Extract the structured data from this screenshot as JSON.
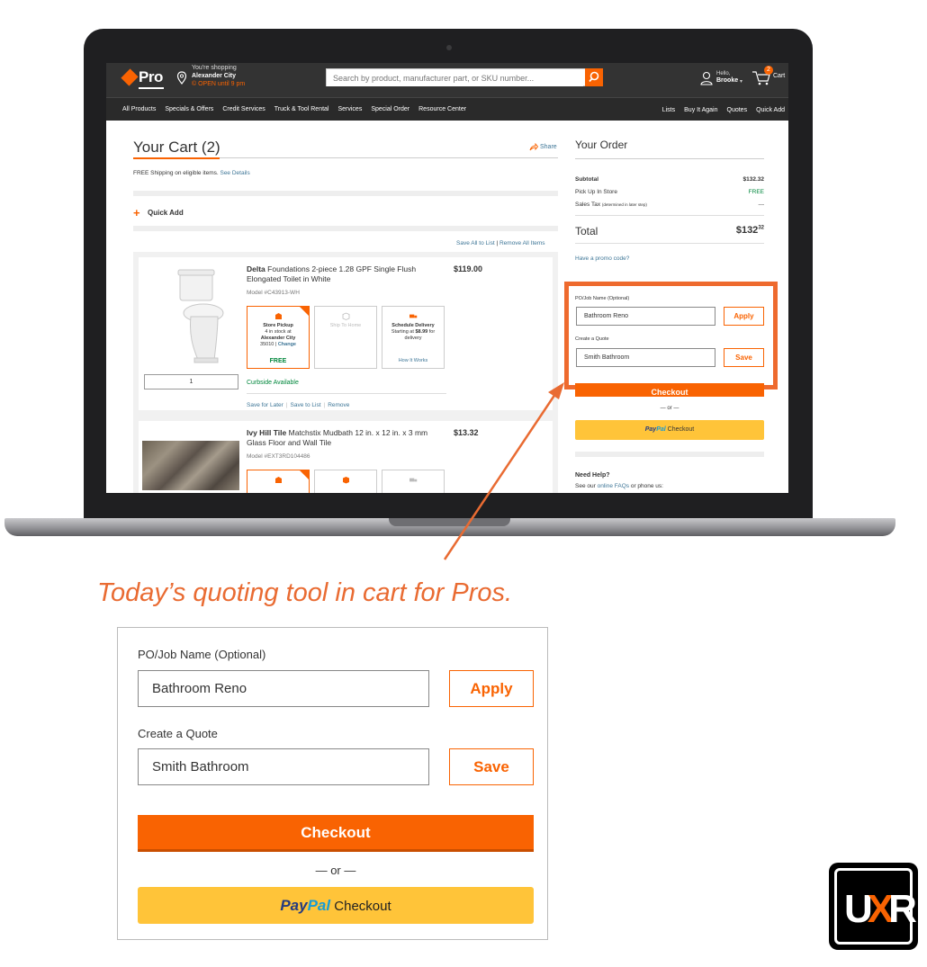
{
  "header": {
    "logo_text": "Pro",
    "shopping_line1": "You're shopping",
    "shopping_store": "Alexander City",
    "shopping_hours": "© OPEN until 9 pm",
    "search_placeholder": "Search by product, manufacturer part, or SKU number...",
    "hello": "Hello,",
    "user_name": "Brooke",
    "cart_count": "2",
    "cart_label": "Cart"
  },
  "nav": {
    "left": [
      "All Products",
      "Specials & Offers",
      "Credit Services",
      "Truck & Tool Rental",
      "Services",
      "Special Order",
      "Resource Center"
    ],
    "right": [
      "Lists",
      "Buy It Again",
      "Quotes",
      "Quick Add"
    ]
  },
  "cart": {
    "title": "Your Cart (2)",
    "share": "Share",
    "free_shipping": "FREE Shipping on eligible items.",
    "see_details": "See Details",
    "quick_add": "Quick Add",
    "save_all": "Save All to List",
    "remove_all": "Remove All Items",
    "items": [
      {
        "brand": "Delta",
        "title": "Foundations 2-piece 1.28 GPF Single Flush Elongated Toilet in White",
        "model": "Model #C43913-WH",
        "price": "$119.00",
        "qty": "1",
        "pickup_title": "Store Pickup",
        "pickup_stock": "4 in stock at",
        "pickup_store": "Alexander City",
        "pickup_zip": "35010",
        "pickup_change": "Change",
        "pickup_free": "FREE",
        "ship_home": "Ship To Home",
        "delivery_title": "Schedule Delivery",
        "delivery_text1": "Starting at",
        "delivery_price": "$8.99",
        "delivery_text2": "for delivery",
        "how_it_works": "How It Works",
        "curbside": "Curbside Available",
        "save_later": "Save for Later",
        "save_list": "Save to List",
        "remove": "Remove"
      },
      {
        "brand": "Ivy Hill Tile",
        "title": "Matchstix Mudbath 12 in. x 12 in. x 3 mm Glass Floor and Wall Tile",
        "model": "Model #EXT3RD104486",
        "price": "$13.32"
      }
    ]
  },
  "order": {
    "title": "Your Order",
    "subtotal_label": "Subtotal",
    "subtotal": "$132.32",
    "pickup_label": "Pick Up In Store",
    "pickup_value": "FREE",
    "tax_label": "Sales Tax",
    "tax_note": "(determined in later step)",
    "tax_value": "---",
    "total_label": "Total",
    "total_dollars": "$132",
    "total_cents": "32",
    "promo": "Have a promo code?",
    "job_label": "PO/Job Name (Optional)",
    "job_value": "Bathroom Reno",
    "apply": "Apply",
    "quote_label": "Create a Quote",
    "quote_value": "Smith Bathroom",
    "save": "Save",
    "checkout": "Checkout",
    "or": "— or —",
    "paypal_1": "Pay",
    "paypal_2": "Pal",
    "paypal_checkout": "Checkout",
    "need_help": "Need Help?",
    "faq_pre": "See our",
    "faq_link": "online FAQs",
    "faq_post": "or phone us:"
  },
  "caption": "Today’s quoting tool in cart for Pros.",
  "zoom": {
    "job_label": "PO/Job Name (Optional)",
    "job_value": "Bathroom Reno",
    "apply": "Apply",
    "quote_label": "Create a Quote",
    "quote_value": "Smith Bathroom",
    "save": "Save",
    "checkout": "Checkout",
    "or": "— or —",
    "paypal_1": "Pay",
    "paypal_2": "Pal",
    "paypal_checkout": "Checkout"
  },
  "badge": {
    "u": "U",
    "x": "X",
    "r": "R"
  },
  "colors": {
    "brand_orange": "#f96302",
    "annotation_orange": "#e96b32",
    "paypal_yellow": "#ffc439",
    "link_blue": "#3e7697",
    "free_green": "#00873c"
  }
}
